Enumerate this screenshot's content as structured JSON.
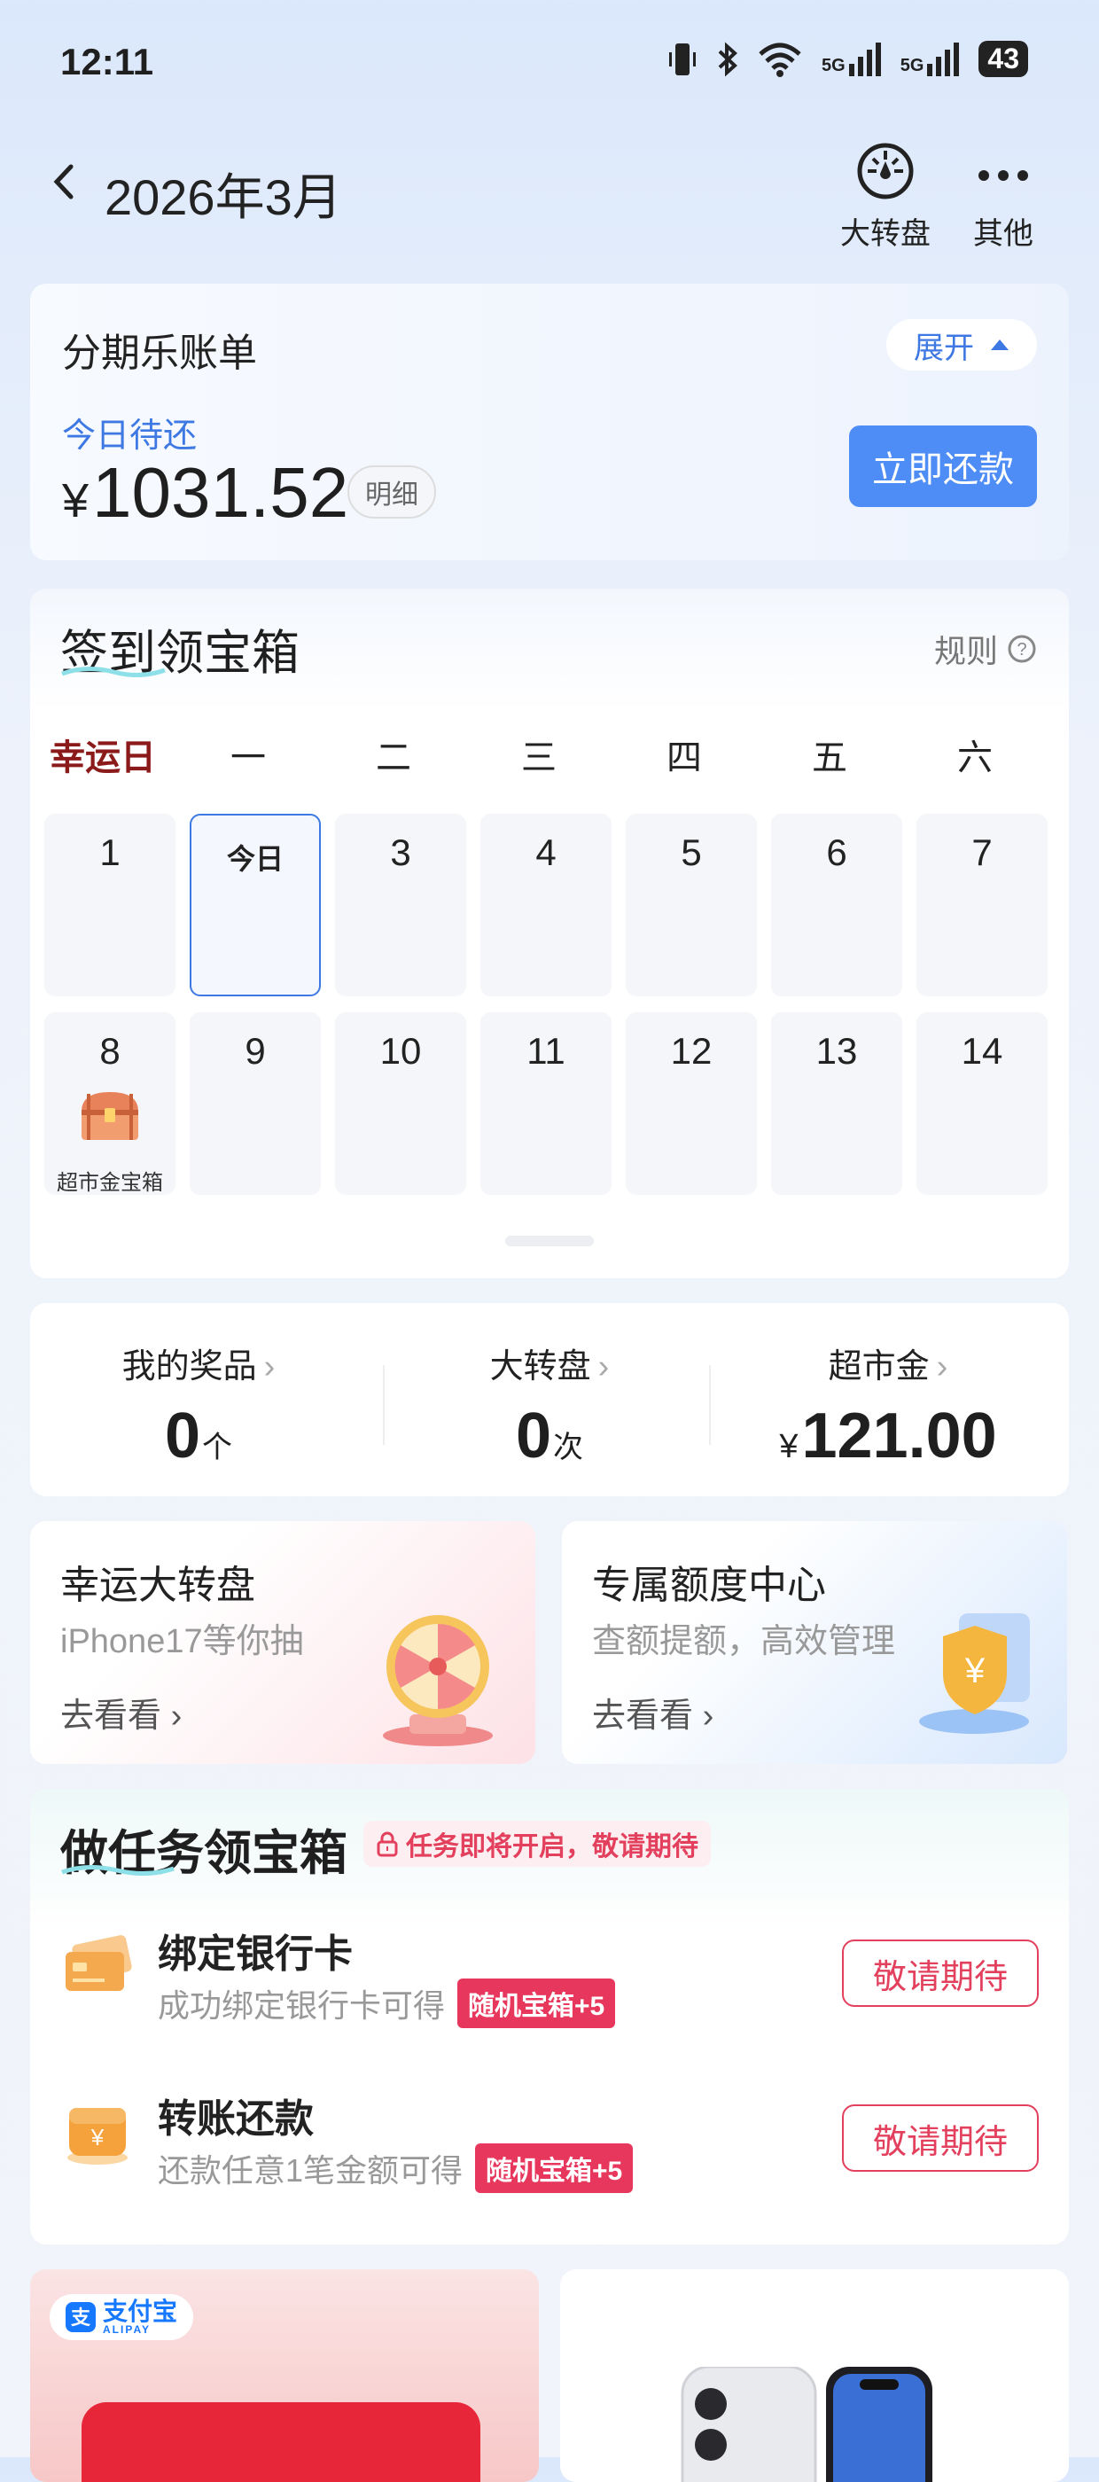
{
  "status_bar": {
    "time": "12:11",
    "battery": "43",
    "signal1": "5G",
    "signal2": "5G"
  },
  "header": {
    "title": "2026年3月",
    "wheel_label": "大转盘",
    "more_label": "其他"
  },
  "bill": {
    "name": "分期乐账单",
    "expand_label": "展开",
    "due_label": "今日待还",
    "currency": "¥",
    "amount": "1031.52",
    "detail_label": "明细",
    "pay_label": "立即还款"
  },
  "checkin": {
    "title": "签到领宝箱",
    "rules_label": "规则",
    "weekdays": [
      "幸运日",
      "一",
      "二",
      "三",
      "四",
      "五",
      "六"
    ],
    "days": [
      "1",
      "今日",
      "3",
      "4",
      "5",
      "6",
      "7",
      "8",
      "9",
      "10",
      "11",
      "12",
      "13",
      "14"
    ],
    "prize_day8": "超市金宝箱"
  },
  "stats": {
    "prizes": {
      "label": "我的奖品",
      "value": "0",
      "unit": "个"
    },
    "wheel": {
      "label": "大转盘",
      "value": "0",
      "unit": "次"
    },
    "market": {
      "label": "超市金",
      "currency": "¥",
      "value": "121.00"
    }
  },
  "promos": {
    "wheel": {
      "title": "幸运大转盘",
      "subtitle": "iPhone17等你抽",
      "link": "去看看"
    },
    "credit": {
      "title": "专属额度中心",
      "subtitle": "查额提额，高效管理",
      "link": "去看看"
    }
  },
  "tasks": {
    "title": "做任务领宝箱",
    "notice": "任务即将开启，敬请期待",
    "items": [
      {
        "name": "绑定银行卡",
        "desc": "成功绑定银行卡可得",
        "tag": "随机宝箱+5",
        "button": "敬请期待"
      },
      {
        "name": "转账还款",
        "desc": "还款任意1笔金额可得",
        "tag": "随机宝箱+5",
        "button": "敬请期待"
      }
    ]
  },
  "bottom": {
    "alipay_label": "支付宝",
    "alipay_sub": "ALIPAY"
  },
  "colors": {
    "accent": "#4f8df6",
    "link_blue": "#3d78e3",
    "task_red": "#e3405e",
    "lucky_red": "#8b1a1a"
  }
}
